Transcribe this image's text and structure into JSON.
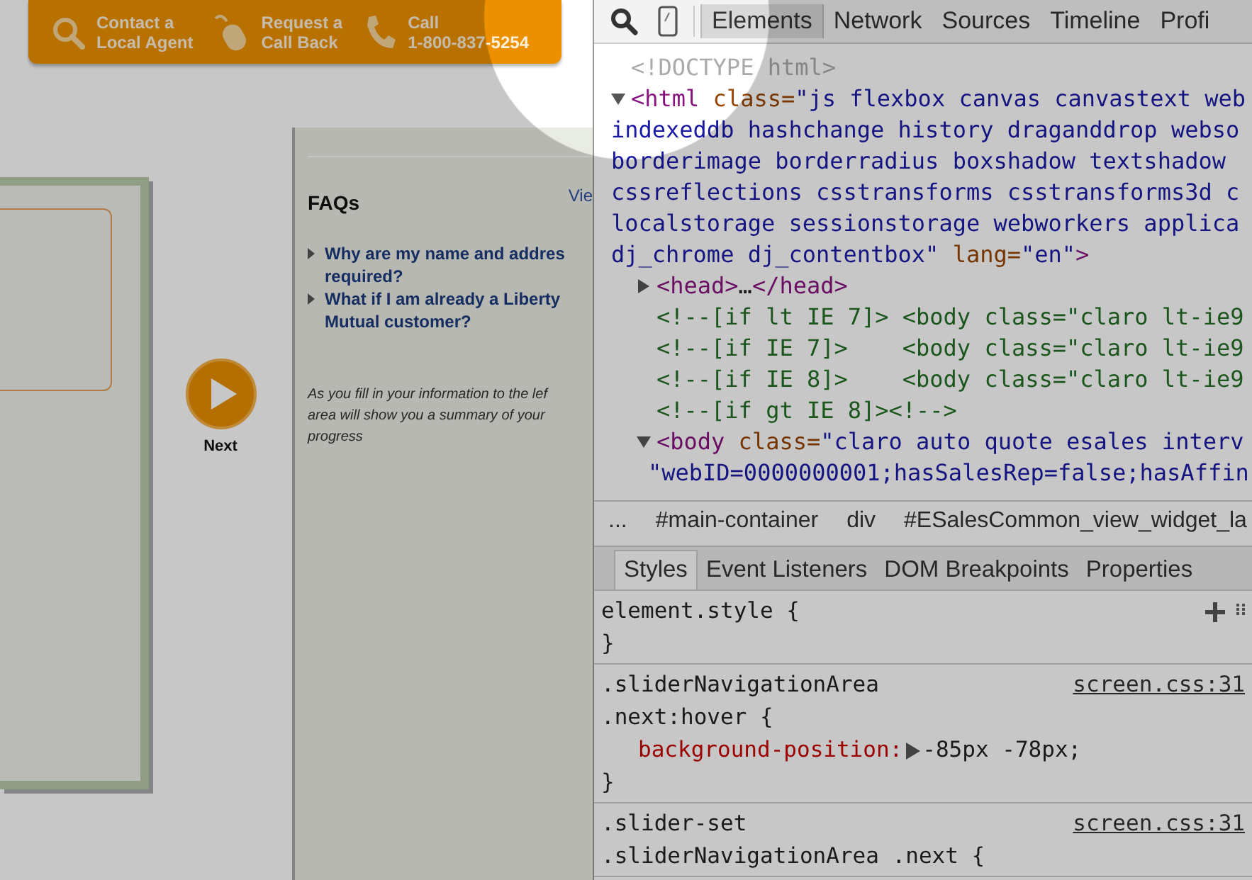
{
  "web_page": {
    "header_bar": [
      {
        "kind": "search",
        "lines": [
          "Contact a",
          "Local Agent"
        ]
      },
      {
        "kind": "mouse",
        "lines": [
          "Request a",
          "Call Back"
        ]
      },
      {
        "kind": "phone",
        "lines": [
          "Call",
          "1-800-837-5254"
        ]
      }
    ],
    "next_button": {
      "label": "Next"
    },
    "faq_panel": {
      "title": "FAQs",
      "view_link": "Vie",
      "items": [
        {
          "lines": [
            "Why are my name and addres",
            "required?"
          ]
        },
        {
          "lines": [
            "What if I am already a Liberty",
            "Mutual customer?"
          ]
        }
      ],
      "note_lines": [
        "As you fill in your information to the lef",
        "area will show you a summary of your",
        "progress"
      ]
    }
  },
  "devtools": {
    "tabs": [
      {
        "label": "Elements",
        "selected": true
      },
      {
        "label": "Network",
        "selected": false
      },
      {
        "label": "Sources",
        "selected": false
      },
      {
        "label": "Timeline",
        "selected": false
      },
      {
        "label": "Profi",
        "selected": false
      }
    ],
    "dom_tree": [
      {
        "lines": [
          [
            {
              "kind": "doctype",
              "text": "<!DOCTYPE html>"
            }
          ]
        ]
      },
      {
        "expanded": true,
        "lines": [
          [
            {
              "kind": "tag",
              "text": "<html"
            },
            {
              "kind": "attr",
              "text": " class="
            },
            {
              "kind": "value",
              "text": "\"js flexbox canvas canvastext web"
            }
          ],
          [
            {
              "kind": "value",
              "text": "indexeddb hashchange history draganddrop webso"
            }
          ],
          [
            {
              "kind": "value",
              "text": "borderimage borderradius boxshadow textshadow "
            }
          ],
          [
            {
              "kind": "value",
              "text": "cssreflections csstransforms csstransforms3d c"
            }
          ],
          [
            {
              "kind": "value",
              "text": "localstorage sessionstorage webworkers applica"
            }
          ],
          [
            {
              "kind": "value",
              "text": "dj_chrome dj_contentbox\""
            },
            {
              "kind": "attr",
              "text": " lang="
            },
            {
              "kind": "value",
              "text": "\"en\""
            },
            {
              "kind": "tag",
              "text": ">"
            }
          ]
        ],
        "children": [
          {
            "expanded": false,
            "lines": [
              [
                {
                  "kind": "tag",
                  "text": "<head>"
                },
                {
                  "kind": "text",
                  "text": "…"
                },
                {
                  "kind": "tag",
                  "text": "</head>"
                }
              ]
            ]
          },
          {
            "lines": [
              [
                {
                  "kind": "comment",
                  "text": "<!--[if lt IE 7]> <body class=\"claro lt-ie9"
                }
              ]
            ]
          },
          {
            "lines": [
              [
                {
                  "kind": "comment",
                  "text": "<!--[if IE 7]>    <body class=\"claro lt-ie9"
                }
              ]
            ]
          },
          {
            "lines": [
              [
                {
                  "kind": "comment",
                  "text": "<!--[if IE 8]>    <body class=\"claro lt-ie9"
                }
              ]
            ]
          },
          {
            "lines": [
              [
                {
                  "kind": "comment",
                  "text": "<!--[if gt IE 8]><!-->"
                }
              ]
            ]
          },
          {
            "expanded": true,
            "lines": [
              [
                {
                  "kind": "tag",
                  "text": "<body"
                },
                {
                  "kind": "attr",
                  "text": " class="
                },
                {
                  "kind": "value",
                  "text": "\"claro auto quote esales interv"
                }
              ],
              [
                {
                  "kind": "value",
                  "text": "\"webID=0000000001;hasSalesRep=false;hasAffin"
                }
              ]
            ]
          }
        ]
      }
    ],
    "breadcrumbs": [
      "...",
      "#main-container",
      "div",
      "#ESalesCommon_view_widget_la"
    ],
    "sub_tabs": [
      {
        "label": "Styles",
        "selected": true
      },
      {
        "label": "Event Listeners",
        "selected": false
      },
      {
        "label": "DOM Breakpoints",
        "selected": false
      },
      {
        "label": "Properties",
        "selected": false
      }
    ],
    "rules": [
      {
        "selector_lines": [
          "element.style {"
        ],
        "tools": true,
        "closing": "}"
      },
      {
        "selector_lines": [
          ".sliderNavigationArea",
          ".next:hover {"
        ],
        "source": "screen.css:31",
        "declarations": [
          {
            "property": "background-position:",
            "value": "-85px -78px;"
          }
        ],
        "closing": "}"
      },
      {
        "selector_lines": [
          ".slider-set",
          ".sliderNavigationArea .next {"
        ],
        "source": "screen.css:31"
      }
    ]
  }
}
